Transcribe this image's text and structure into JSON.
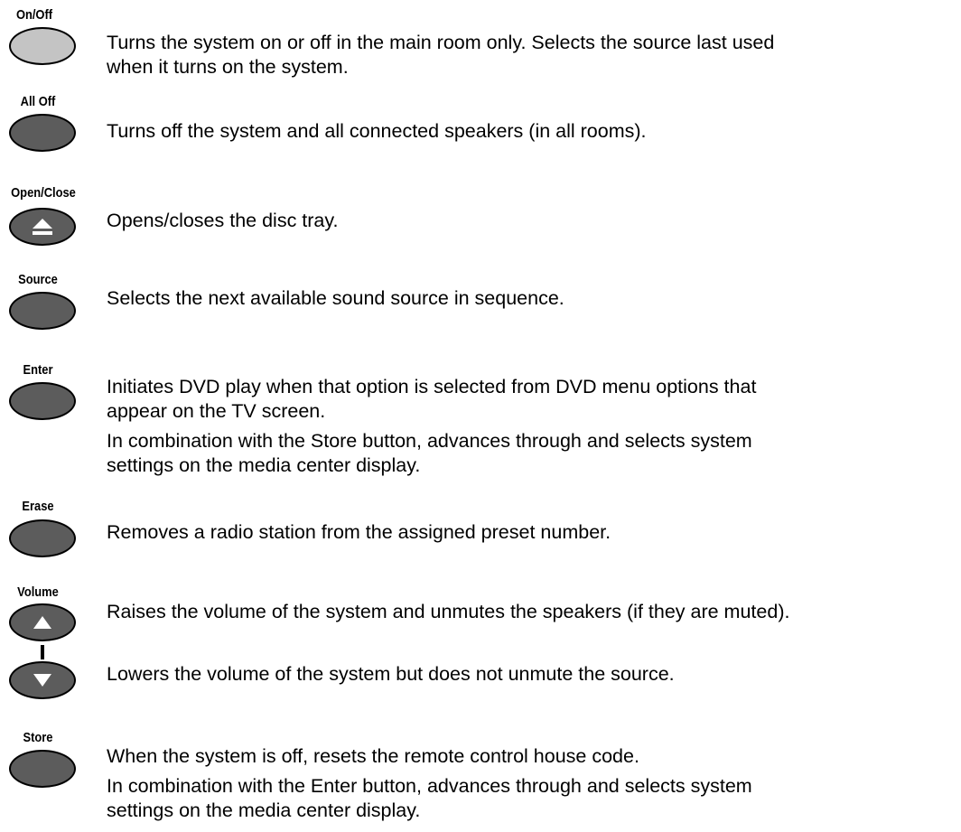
{
  "buttons": {
    "on_off": {
      "label": "On/Off"
    },
    "all_off": {
      "label": "All Off"
    },
    "open_close": {
      "label": "Open/Close"
    },
    "source": {
      "label": "Source"
    },
    "enter": {
      "label": "Enter"
    },
    "erase": {
      "label": "Erase"
    },
    "volume": {
      "label": "Volume"
    },
    "store": {
      "label": "Store"
    }
  },
  "descriptions": {
    "on_off_1": "Turns the system on or off in the main room only. Selects the source last used",
    "on_off_2": "when it turns on the system.",
    "all_off": "Turns off the system and all connected speakers (in all rooms).",
    "open_close": "Opens/closes the disc tray.",
    "source": "Selects the next available sound source in sequence.",
    "enter_1": "Initiates DVD play when that option is selected from DVD menu options that",
    "enter_2": "appear on the TV screen.",
    "enter_3": "In combination with the Store button, advances through and selects system",
    "enter_4": "settings on the media center display.",
    "erase": "Removes a radio station from the assigned preset number.",
    "volume_up": "Raises the volume of the system and unmutes the speakers (if they are muted).",
    "volume_down": "Lowers the volume of the system but does not unmute the source.",
    "store_1": "When the system is off, resets the remote control house code.",
    "store_2": "In combination with the Enter button, advances through and selects system",
    "store_3": "settings on the media center display."
  },
  "icons": {
    "eject": "eject-icon",
    "up": "triangle-up-icon",
    "down": "triangle-down-icon"
  },
  "colors": {
    "button_dark": "#5c5c5c",
    "button_light": "#c4c4c4"
  }
}
